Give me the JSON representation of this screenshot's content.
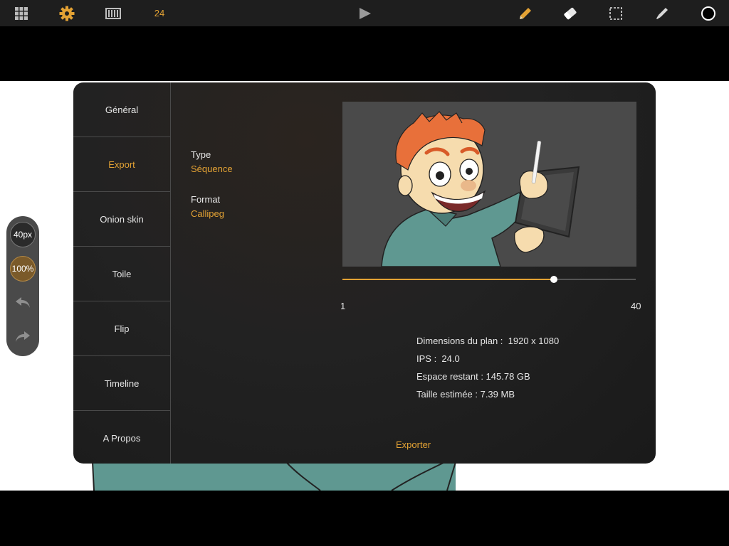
{
  "toolbar": {
    "fps_value": "24",
    "icons": [
      "grid-icon",
      "gear-icon",
      "film-icon",
      "play-icon",
      "pencil-icon",
      "eraser-icon",
      "selection-icon",
      "eyedropper-icon",
      "color-swatch-icon"
    ],
    "accent": "#e3a234"
  },
  "tools": {
    "brush_size": "40px",
    "opacity": "100%"
  },
  "settings_menu": {
    "items": [
      {
        "label": "Général"
      },
      {
        "label": "Export"
      },
      {
        "label": "Onion skin"
      },
      {
        "label": "Toile"
      },
      {
        "label": "Flip"
      },
      {
        "label": "Timeline"
      },
      {
        "label": "A Propos"
      }
    ],
    "active": "Export"
  },
  "export": {
    "type_label": "Type",
    "type_value": "Séquence",
    "format_label": "Format",
    "format_value": "Callipeg",
    "range": {
      "min_label": "1",
      "max_label": "40",
      "current": 0.72
    },
    "info": {
      "dimensions": "Dimensions du plan :  1920 x 1080",
      "fps": "IPS :  24.0",
      "space": "Espace restant : 145.78 GB",
      "size": "Taille estimée : 7.39 MB"
    },
    "export_label": "Exporter"
  }
}
